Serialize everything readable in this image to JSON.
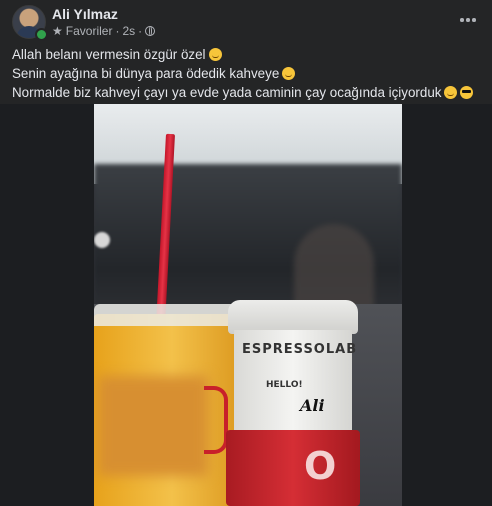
{
  "post": {
    "author": "Ali Yılmaz",
    "audience": "Favoriler",
    "separator": "·",
    "time": "2s",
    "lines": [
      "Allah belanı vermesin özgür özel",
      "Senin ayağına bi dünya para ödedik kahveye",
      "Normalde biz kahveyi çayı ya evde yada caminin çay ocağında içiyorduk"
    ],
    "photo_text": {
      "cup_brand": "ESPRESSOLAB",
      "cup_greeting": "HELLO!",
      "cup_name": "Ali"
    }
  },
  "colors": {
    "background": "#242526",
    "text": "#e4e6eb",
    "secondary_text": "#b0b3b8",
    "online": "#31a24c"
  },
  "icons": {
    "more": "more-horizontal-icon",
    "favorites": "star-icon",
    "privacy": "globe-icon"
  }
}
